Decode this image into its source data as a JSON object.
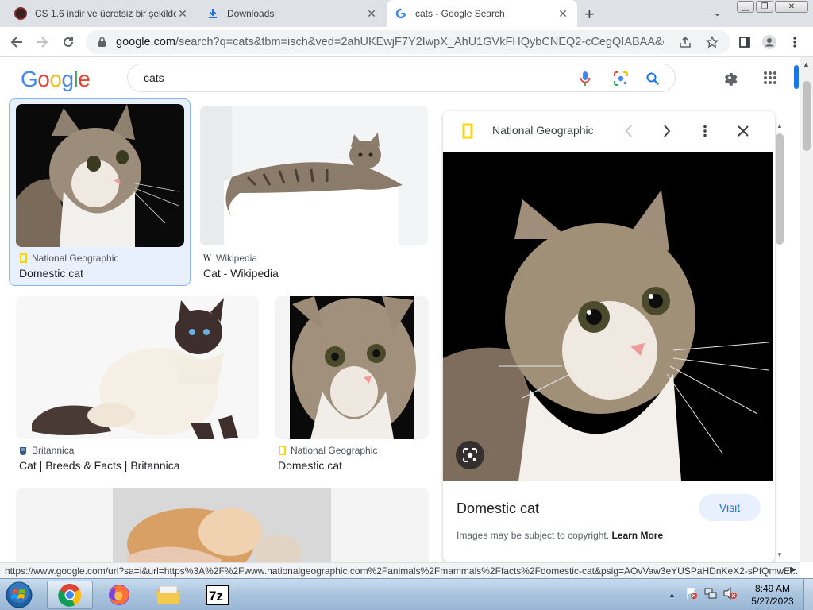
{
  "browser": {
    "tabs": [
      {
        "title": "CS 1.6 indir ve ücretsiz bir şekilde",
        "active": false
      },
      {
        "title": "Downloads",
        "active": false
      },
      {
        "title": "cats - Google Search",
        "active": true
      }
    ],
    "new_tab": "+",
    "tab_menu": "⌄",
    "address": {
      "host": "google.com",
      "rest": "/search?q=cats&tbm=isch&ved=2ahUKEwjF7Y2IwpX_AhU1GVkFHQybCNEQ2-cCegQIABAA&oq=cat..."
    }
  },
  "google": {
    "logo": [
      "G",
      "o",
      "o",
      "g",
      "l",
      "e"
    ],
    "logo_colors": [
      "#4285F4",
      "#EA4335",
      "#FBBC05",
      "#4285F4",
      "#34A853",
      "#EA4335"
    ],
    "query": "cats"
  },
  "results": [
    {
      "source": "National Geographic",
      "title": "Domestic cat",
      "selected": true
    },
    {
      "source": "Wikipedia",
      "title": "Cat - Wikipedia",
      "selected": false
    },
    {
      "source": "Britannica",
      "title": "Cat | Breeds & Facts | Britannica",
      "selected": false
    },
    {
      "source": "National Geographic",
      "title": "Domestic cat",
      "selected": false
    }
  ],
  "panel": {
    "source": "National Geographic",
    "title": "Domestic cat",
    "visit_label": "Visit",
    "copyright": "Images may be subject to copyright.",
    "learn_more": "Learn More"
  },
  "status_url": "https://www.google.com/url?sa=i&url=https%3A%2F%2Fwww.nationalgeographic.com%2Fanimals%2Fmammals%2Ffacts%2Fdomestic-cat&psig=AOvVaw3eYUSPaHDnKeX2-sPfQmwE...",
  "taskbar": {
    "time": "8:49 AM",
    "date": "5/27/2023",
    "apps": [
      "chrome-icon",
      "firefox-icon",
      "folder-icon",
      "7zip-icon"
    ]
  },
  "colors": {
    "accent": "#1a73e8",
    "natgeo_yellow": "#FFD400"
  }
}
